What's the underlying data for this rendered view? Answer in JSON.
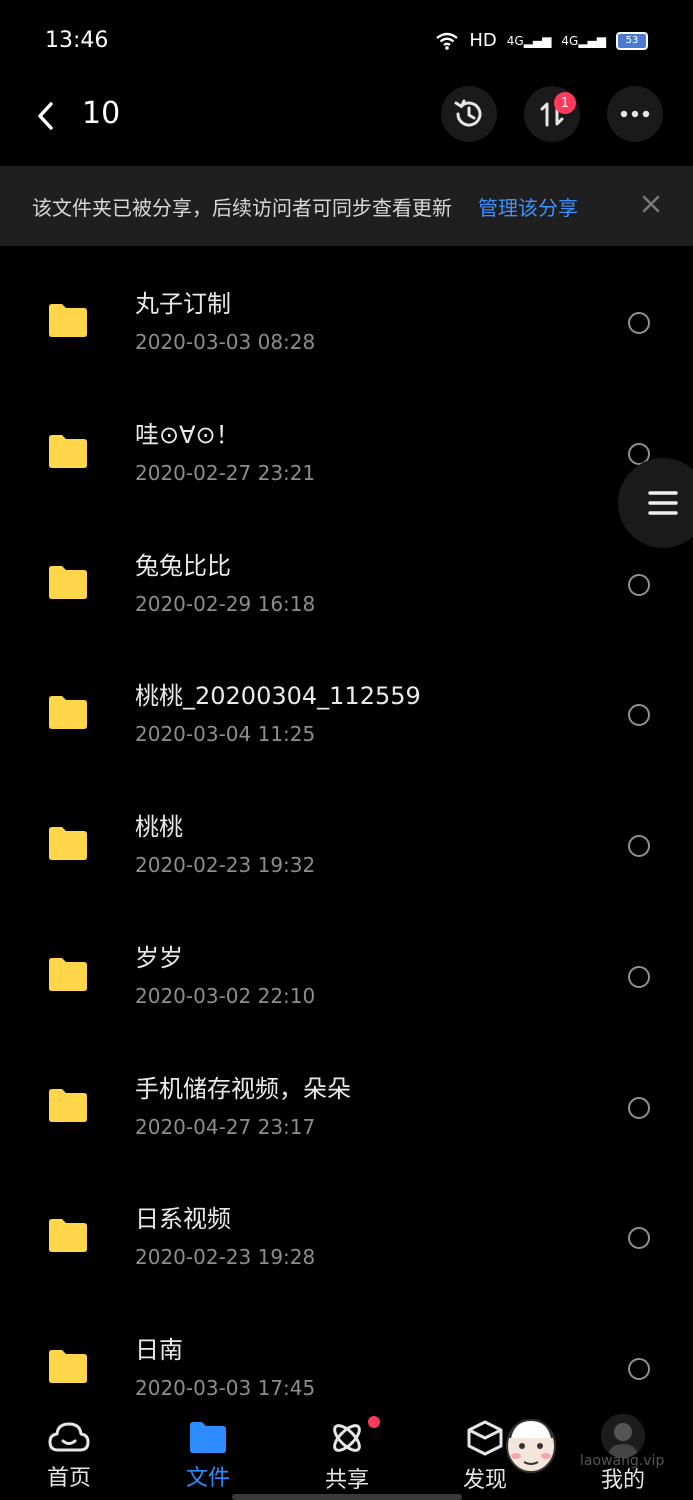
{
  "status_bar": {
    "time": "13:46",
    "network_1": "HD",
    "network_2": "4G",
    "network_3": "4G",
    "battery": "53"
  },
  "header": {
    "title": "10",
    "transfer_badge": "1"
  },
  "share_banner": {
    "message": "该文件夹已被分享，后续访问者可同步查看更新",
    "manage_link": "管理该分享"
  },
  "files": [
    {
      "name": "丸子订制",
      "date": "2020-03-03  08:28"
    },
    {
      "name": "哇⊙∀⊙！",
      "date": "2020-02-27  23:21"
    },
    {
      "name": "兔兔比比",
      "date": "2020-02-29  16:18"
    },
    {
      "name": "桃桃_20200304_112559",
      "date": "2020-03-04  11:25"
    },
    {
      "name": "桃桃",
      "date": "2020-02-23  19:32"
    },
    {
      "name": "岁岁",
      "date": "2020-03-02  22:10"
    },
    {
      "name": "手机储存视频，朵朵",
      "date": "2020-04-27  23:17"
    },
    {
      "name": "日系视频",
      "date": "2020-02-23  19:28"
    },
    {
      "name": "日南",
      "date": "2020-03-03  17:45"
    }
  ],
  "bottom_nav": {
    "items": [
      {
        "label": "首页"
      },
      {
        "label": "文件"
      },
      {
        "label": "共享"
      },
      {
        "label": "发现"
      },
      {
        "label": "我的"
      }
    ]
  },
  "watermark": "laowang.vip",
  "colors": {
    "accent": "#2d8cff",
    "folder": "#ffd54a",
    "badge": "#ff3b5c"
  }
}
